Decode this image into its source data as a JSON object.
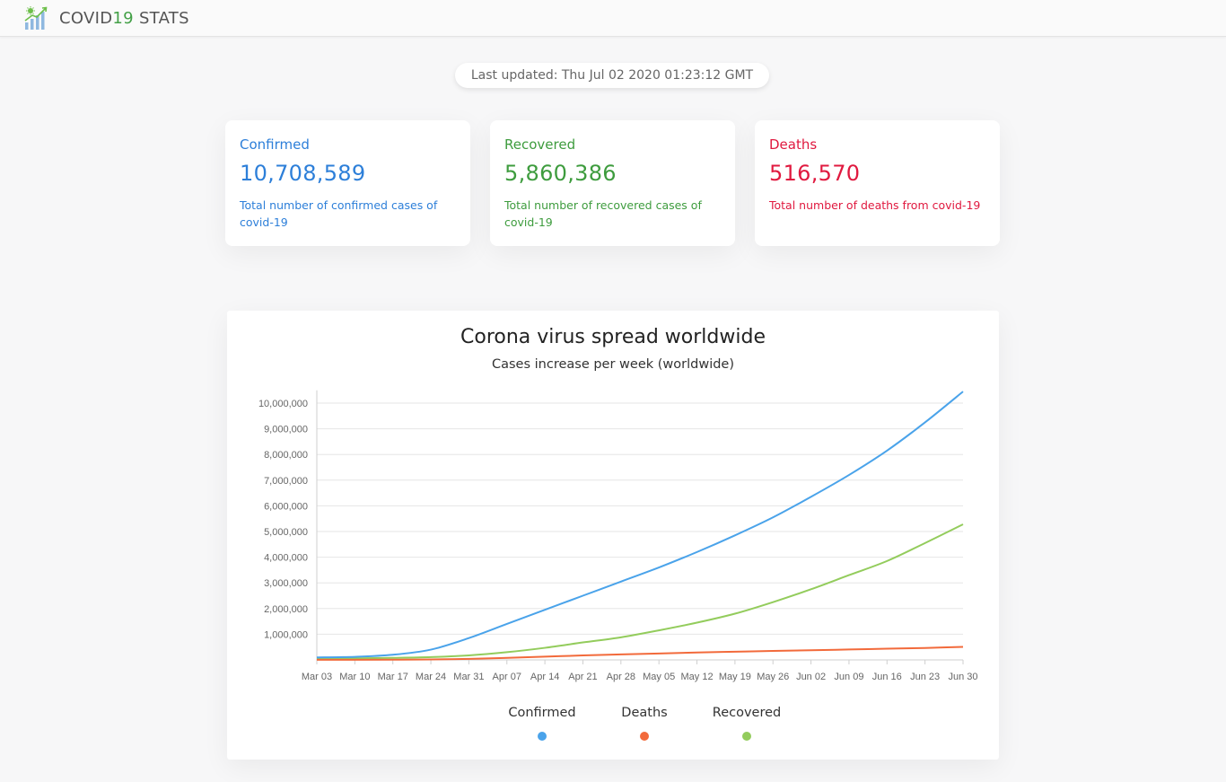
{
  "app": {
    "brand_prefix": "COVID",
    "brand_number": "19",
    "brand_suffix": " STATS"
  },
  "last_updated": "Last updated: Thu Jul 02 2020 01:23:12 GMT",
  "cards": {
    "confirmed": {
      "title": "Confirmed",
      "value": "10,708,589",
      "description": "Total number of confirmed cases of covid-19",
      "color": "#2d7fd9"
    },
    "recovered": {
      "title": "Recovered",
      "value": "5,860,386",
      "description": "Total number of recovered cases of covid-19",
      "color": "#3e9c3e"
    },
    "deaths": {
      "title": "Deaths",
      "value": "516,570",
      "description": "Total number of deaths from covid-19",
      "color": "#e0193f"
    }
  },
  "chart_data": {
    "type": "line",
    "title": "Corona virus spread worldwide",
    "subtitle": "Cases increase per week (worldwide)",
    "categories": [
      "Mar 03",
      "Mar 10",
      "Mar 17",
      "Mar 24",
      "Mar 31",
      "Apr 07",
      "Apr 14",
      "Apr 21",
      "Apr 28",
      "May 05",
      "May 12",
      "May 19",
      "May 26",
      "Jun 02",
      "Jun 09",
      "Jun 16",
      "Jun 23",
      "Jun 30"
    ],
    "series": [
      {
        "name": "Confirmed",
        "color": "#4aa3ea",
        "values": [
          95000,
          120000,
          200000,
          400000,
          850000,
          1400000,
          1950000,
          2500000,
          3050000,
          3600000,
          4200000,
          4850000,
          5550000,
          6350000,
          7200000,
          8150000,
          9250000,
          10450000
        ]
      },
      {
        "name": "Deaths",
        "color": "#f26a3b",
        "values": [
          3200,
          4000,
          8000,
          17000,
          40000,
          80000,
          125000,
          175000,
          215000,
          250000,
          290000,
          320000,
          350000,
          375000,
          405000,
          435000,
          465000,
          505000
        ]
      },
      {
        "name": "Recovered",
        "color": "#93cc5c",
        "values": [
          50000,
          60000,
          80000,
          110000,
          175000,
          300000,
          470000,
          680000,
          880000,
          1150000,
          1450000,
          1800000,
          2250000,
          2750000,
          3300000,
          3850000,
          4550000,
          5280000
        ]
      }
    ],
    "yticks": [
      "1,000,000",
      "2,000,000",
      "3,000,000",
      "4,000,000",
      "5,000,000",
      "6,000,000",
      "7,000,000",
      "8,000,000",
      "9,000,000",
      "10,000,000"
    ],
    "ylim": [
      0,
      10500000
    ],
    "grid": true,
    "legend_position": "bottom"
  }
}
